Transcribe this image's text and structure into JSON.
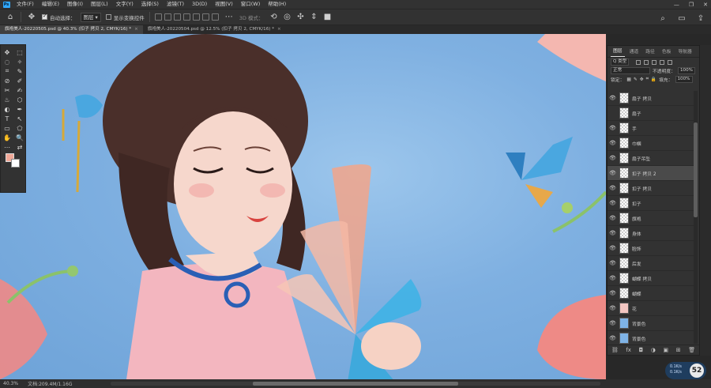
{
  "menubar": {
    "app_logo": "Ps",
    "items": [
      "文件(F)",
      "编辑(E)",
      "图像(I)",
      "图层(L)",
      "文字(Y)",
      "选择(S)",
      "滤镜(T)",
      "3D(D)",
      "视图(V)",
      "窗口(W)",
      "帮助(H)"
    ],
    "controls": [
      "—",
      "❐",
      "✕"
    ]
  },
  "optionsbar": {
    "auto_select_label": "自动选择：",
    "auto_select_checked": true,
    "target_value": "图层",
    "show_transform_label": "显示变换控件",
    "show_transform_checked": false,
    "mode3d_label": "3D 模式："
  },
  "tabs": [
    {
      "title": "旗袍美人-20220505.psd @ 40.3% (扣子 拷贝 2, CMYK/16) *",
      "close": "×",
      "active": true
    },
    {
      "title": "旗袍美人-20220504.psd @ 12.5% (扣子 拷贝 2, CMYK/16) *",
      "close": "×",
      "active": false
    }
  ],
  "toolbar": {
    "tools": [
      "✥",
      "⬚",
      "◌",
      "✧",
      "⌗",
      "✎",
      "⊘",
      "✐",
      "✂",
      "✍",
      "♨",
      "⬡",
      "◐",
      "✒",
      "T",
      "↖",
      "▭",
      "⬠",
      "✋",
      "🔍",
      "⋯",
      "⇄"
    ],
    "foreground_color": "#f0a898",
    "background_color": "#ffffff"
  },
  "layers_panel": {
    "tabs": [
      "图层",
      "通道",
      "路径",
      "色板",
      "导航器"
    ],
    "active_tab": "图层",
    "filter_label": "Q 类型",
    "blend_mode": "正常",
    "opacity_label": "不透明度：",
    "opacity_value": "100%",
    "lock_label": "锁定：",
    "fill_label": "填充：",
    "fill_value": "100%",
    "layers": [
      {
        "name": "扇子 拷贝",
        "visible": true,
        "selected": false,
        "thumb": "checker"
      },
      {
        "name": "扇子",
        "visible": false,
        "selected": false,
        "thumb": "checker"
      },
      {
        "name": "手",
        "visible": true,
        "selected": false,
        "thumb": "checker"
      },
      {
        "name": "巾帼",
        "visible": true,
        "selected": false,
        "thumb": "checker"
      },
      {
        "name": "扇子吊坠",
        "visible": true,
        "selected": false,
        "thumb": "checker"
      },
      {
        "name": "扣子 拷贝 2",
        "visible": true,
        "selected": true,
        "thumb": "checker"
      },
      {
        "name": "扣子 拷贝",
        "visible": true,
        "selected": false,
        "thumb": "checker"
      },
      {
        "name": "扣子",
        "visible": true,
        "selected": false,
        "thumb": "checker"
      },
      {
        "name": "旗袍",
        "visible": true,
        "selected": false,
        "thumb": "checker"
      },
      {
        "name": "身体",
        "visible": true,
        "selected": false,
        "thumb": "checker"
      },
      {
        "name": "脸饰",
        "visible": true,
        "selected": false,
        "thumb": "checker"
      },
      {
        "name": "后发",
        "visible": true,
        "selected": false,
        "thumb": "checker"
      },
      {
        "name": "蝴蝶 拷贝",
        "visible": true,
        "selected": false,
        "thumb": "checker"
      },
      {
        "name": "蝴蝶",
        "visible": true,
        "selected": false,
        "thumb": "checker"
      },
      {
        "name": "花",
        "visible": true,
        "selected": false,
        "thumb": "pink"
      },
      {
        "name": "背景色",
        "visible": true,
        "selected": false,
        "thumb": "blue"
      },
      {
        "name": "背景色",
        "visible": true,
        "selected": false,
        "thumb": "blue"
      }
    ],
    "footer_icons": [
      "⛓",
      "fx",
      "◘",
      "◑",
      "▣",
      "⊞",
      "🗑"
    ]
  },
  "status": {
    "zoom": "40.3%",
    "doc_info": "文档:209.4M/1.16G"
  },
  "perf_badge": {
    "value": "52",
    "line1": "0.1K/s",
    "line2": "0.1K/s"
  }
}
